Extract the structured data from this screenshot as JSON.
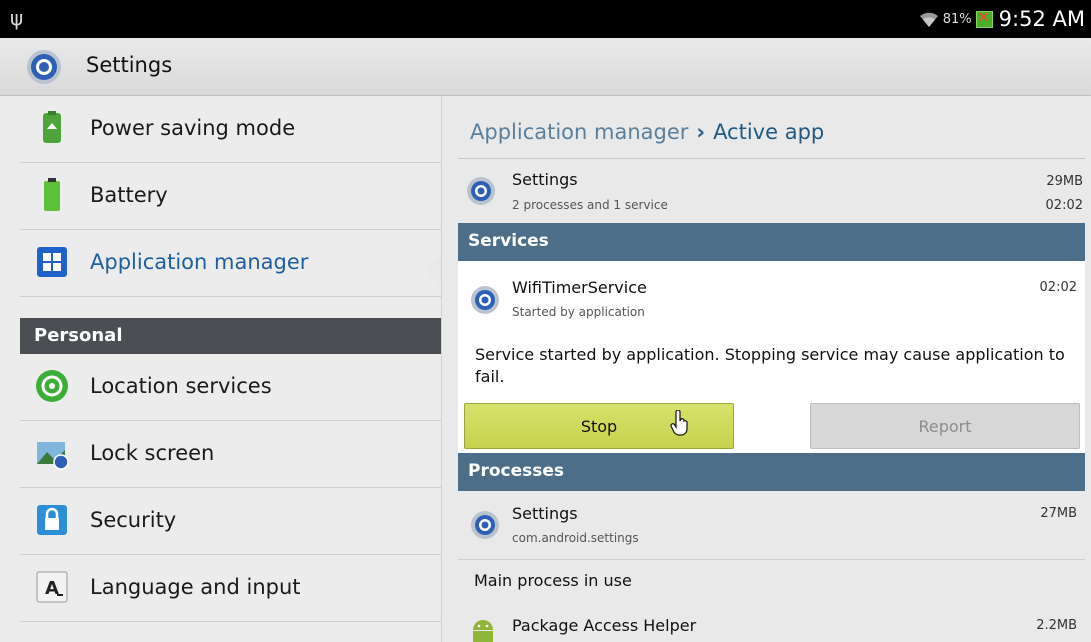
{
  "status_bar": {
    "usb_icon": "usb-icon",
    "battery_percent": "81%",
    "time": "9:52 AM"
  },
  "action_bar": {
    "title": "Settings"
  },
  "sidebar": {
    "items": [
      {
        "label": "Power saving mode",
        "icon": "power-saving-icon"
      },
      {
        "label": "Battery",
        "icon": "battery-icon"
      },
      {
        "label": "Application manager",
        "icon": "application-manager-icon",
        "selected": true
      },
      {
        "label": "Location services",
        "icon": "location-icon"
      },
      {
        "label": "Lock screen",
        "icon": "lock-screen-icon"
      },
      {
        "label": "Security",
        "icon": "security-lock-icon"
      },
      {
        "label": "Language and input",
        "icon": "language-icon"
      }
    ],
    "section_header": "Personal"
  },
  "detail": {
    "breadcrumb_parent": "Application manager",
    "breadcrumb_sep": "›",
    "breadcrumb_current": "Active app",
    "app": {
      "name": "Settings",
      "summary": "2 processes and 1 service",
      "memory": "29MB",
      "time": "02:02"
    },
    "services_header": "Services",
    "service": {
      "name": "WifiTimerService",
      "sub": "Started by application",
      "time": "02:02"
    },
    "service_description": "Service started by application. Stopping service may cause application to fail.",
    "stop_label": "Stop",
    "report_label": "Report",
    "processes_header": "Processes",
    "processes": [
      {
        "name": "Settings",
        "package": "com.android.settings",
        "memory": "27MB"
      },
      {
        "name": "Package Access Helper",
        "memory": "2.2MB"
      }
    ],
    "main_process_text": "Main process in use"
  },
  "colors": {
    "accent": "#1e5e9e",
    "band": "#4c6e88",
    "stop_button": "#c6d24d"
  }
}
